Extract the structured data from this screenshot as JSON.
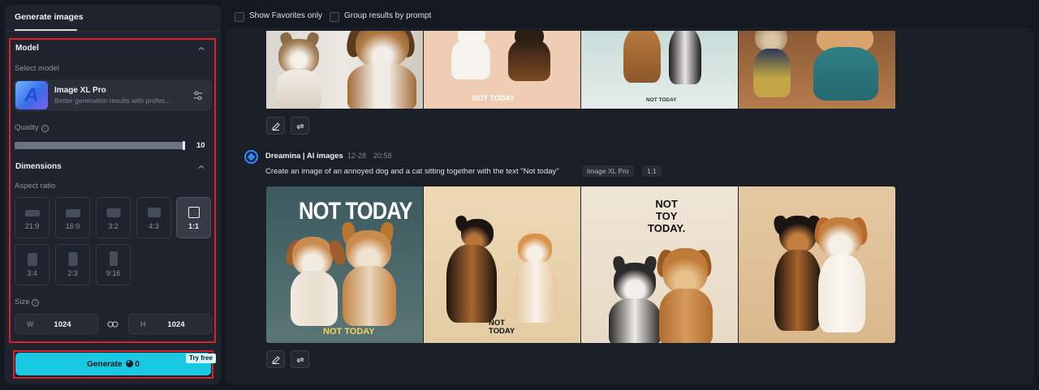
{
  "left_panel": {
    "tab_label": "Generate images",
    "model_section": {
      "title": "Model",
      "select_label": "Select model",
      "model_name": "Image XL Pro",
      "model_desc": "Better generation results with profes..."
    },
    "quality": {
      "label": "Quality",
      "value": "10",
      "level_fraction": 1.0
    },
    "dimensions": {
      "title": "Dimensions",
      "aspect_label": "Aspect ratio",
      "ratios": [
        "21:9",
        "16:9",
        "3:2",
        "4:3",
        "1:1",
        "3:4",
        "2:3",
        "9:16"
      ],
      "selected": "1:1"
    },
    "size": {
      "label": "Size",
      "w_prefix": "W",
      "h_prefix": "H",
      "width": "1024",
      "height": "1024"
    },
    "generate": {
      "label": "Generate",
      "credits": "0",
      "badge": "Try free"
    }
  },
  "toolbar": {
    "show_favorites": "Show Favorites only",
    "group_results": "Group results by prompt"
  },
  "results": [
    {
      "images": [
        {
          "desc": "kitten-and-dog-portrait"
        },
        {
          "desc": "dog-and-puppy-on-peach"
        },
        {
          "desc": "two-dogs-on-mint"
        },
        {
          "desc": "cat-and-dog-in-sweaters"
        }
      ],
      "image_text": {
        "img2": "NOT TODAY",
        "img3": "NOT TODAY"
      }
    },
    {
      "author": "Dreamina | AI images",
      "date": "12-28",
      "time": "20:58",
      "prompt": "Create an image of an annoyed dog and a cat sitting together with the text \"Not today\"",
      "model_tag": "Image XL Pro",
      "ratio_tag": "1:1",
      "image_text": {
        "img1_top": "NOT TODAY",
        "img1_bottom": "NOT TODAY",
        "img2_bottom": "NOT\nTODAY",
        "img3_top": "NOT\nTOY\nTODAY."
      }
    }
  ],
  "colors": {
    "accent": "#19c8e2",
    "highlight": "#d8232a",
    "brand_blue": "#2f8cff"
  }
}
